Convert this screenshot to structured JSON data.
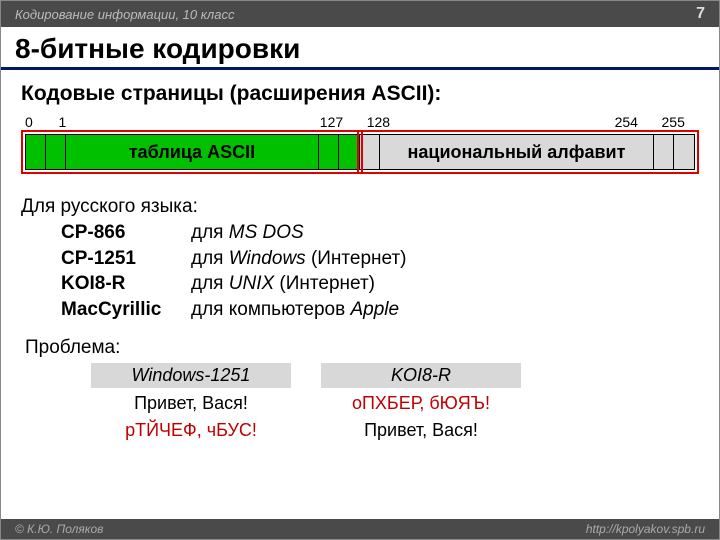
{
  "header": {
    "topic": "Кодирование информации, 10 класс",
    "page": "7"
  },
  "title": "8-битные кодировки",
  "subtitle": "Кодовые страницы (расширения ASCII):",
  "diagram": {
    "l0": "0",
    "l1": "1",
    "l127": "127",
    "l128": "128",
    "l254": "254",
    "l255": "255",
    "ascii_label": "таблица ASCII",
    "nat_label": "национальный алфавит"
  },
  "list_intro": "Для русского языка:",
  "codepages": [
    {
      "code": "CP-866",
      "pre": "для ",
      "it": "MS DOS",
      "post": ""
    },
    {
      "code": "CP-1251",
      "pre": "для ",
      "it": "Windows",
      "post": " (Интернет)"
    },
    {
      "code": "KOI8-R",
      "pre": "для ",
      "it": "UNIX",
      "post": " (Интернет)"
    },
    {
      "code": "MacCyrillic",
      "pre": "для компьютеров ",
      "it": "Apple",
      "post": ""
    }
  ],
  "problem_label": "Проблема:",
  "cols": {
    "a_head": "Windows-1251",
    "b_head": "KOI8-R",
    "a_ok": "Привет, Вася!",
    "b_ok": "Привет, Вася!",
    "a_bad": "рТЙЧЕФ, чБУС!",
    "b_bad": "оПХБЕР, бЮЯЪ!"
  },
  "footer": {
    "left": "© К.Ю. Поляков",
    "right": "http://kpolyakov.spb.ru"
  }
}
